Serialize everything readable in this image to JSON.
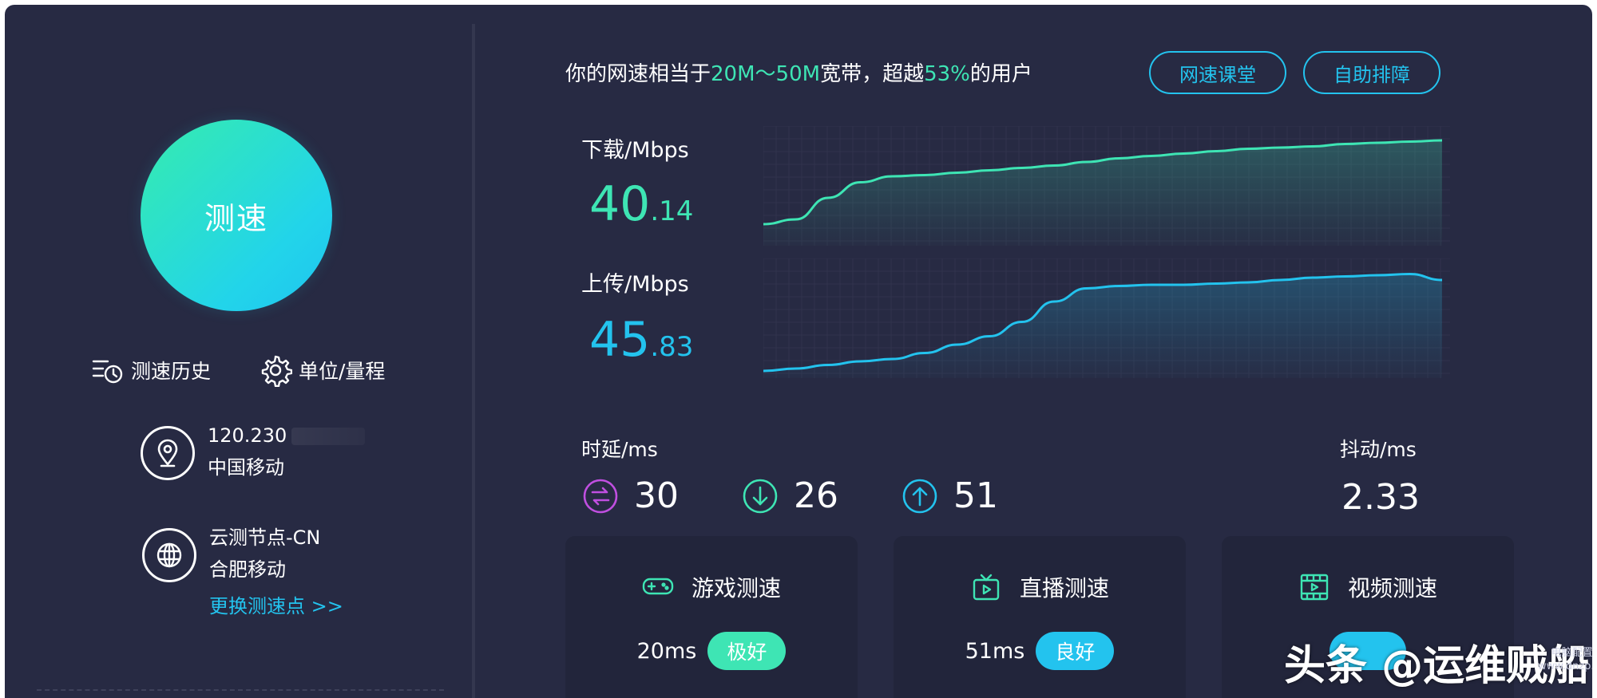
{
  "colors": {
    "background": "#272a43",
    "card": "#22253b",
    "accent_green": "#3ee5b4",
    "accent_blue": "#23c3ee",
    "latency_purple": "#c04fe0"
  },
  "start_button": {
    "label": "测速"
  },
  "left_links": {
    "history": "测速历史",
    "units": "单位/量程"
  },
  "network": {
    "ip": "120.230",
    "isp": "中国移动"
  },
  "node": {
    "name": "云测节点-CN",
    "isp": "合肥移动",
    "change_link": "更换测速点 >>"
  },
  "summary": {
    "prefix": "你的网速相当于",
    "bandwidth": "20M～50M",
    "middle": "宽带，超越",
    "percent": "53%",
    "suffix": "的用户"
  },
  "header_buttons": {
    "classroom": "网速课堂",
    "self_help": "自助排障"
  },
  "download": {
    "label": "下载/Mbps",
    "value_int": "40",
    "value_dec": ".14",
    "trend": [
      0.18,
      0.22,
      0.4,
      0.53,
      0.58,
      0.59,
      0.61,
      0.63,
      0.65,
      0.67,
      0.7,
      0.73,
      0.75,
      0.77,
      0.79,
      0.81,
      0.82,
      0.83,
      0.85,
      0.86,
      0.87,
      0.88
    ]
  },
  "upload": {
    "label": "上传/Mbps",
    "value_int": "45",
    "value_dec": ".83",
    "trend": [
      0.06,
      0.08,
      0.11,
      0.14,
      0.16,
      0.21,
      0.28,
      0.35,
      0.47,
      0.64,
      0.75,
      0.77,
      0.78,
      0.78,
      0.79,
      0.8,
      0.82,
      0.84,
      0.85,
      0.86,
      0.87,
      0.82
    ]
  },
  "latency": {
    "label": "时延/ms",
    "average": "30",
    "download": "26",
    "upload": "51"
  },
  "jitter": {
    "label": "抖动/ms",
    "value": "2.33"
  },
  "cards": {
    "game": {
      "title": "游戏测速",
      "ms": "20ms",
      "rating": "极好"
    },
    "live": {
      "title": "直播测速",
      "ms": "51ms",
      "rating": "良好"
    },
    "video": {
      "title": "视频测速"
    }
  },
  "watermark": {
    "main": "头条 @运维贼船",
    "site": "电脑配置网",
    "domain": "www.dnzp.com"
  }
}
